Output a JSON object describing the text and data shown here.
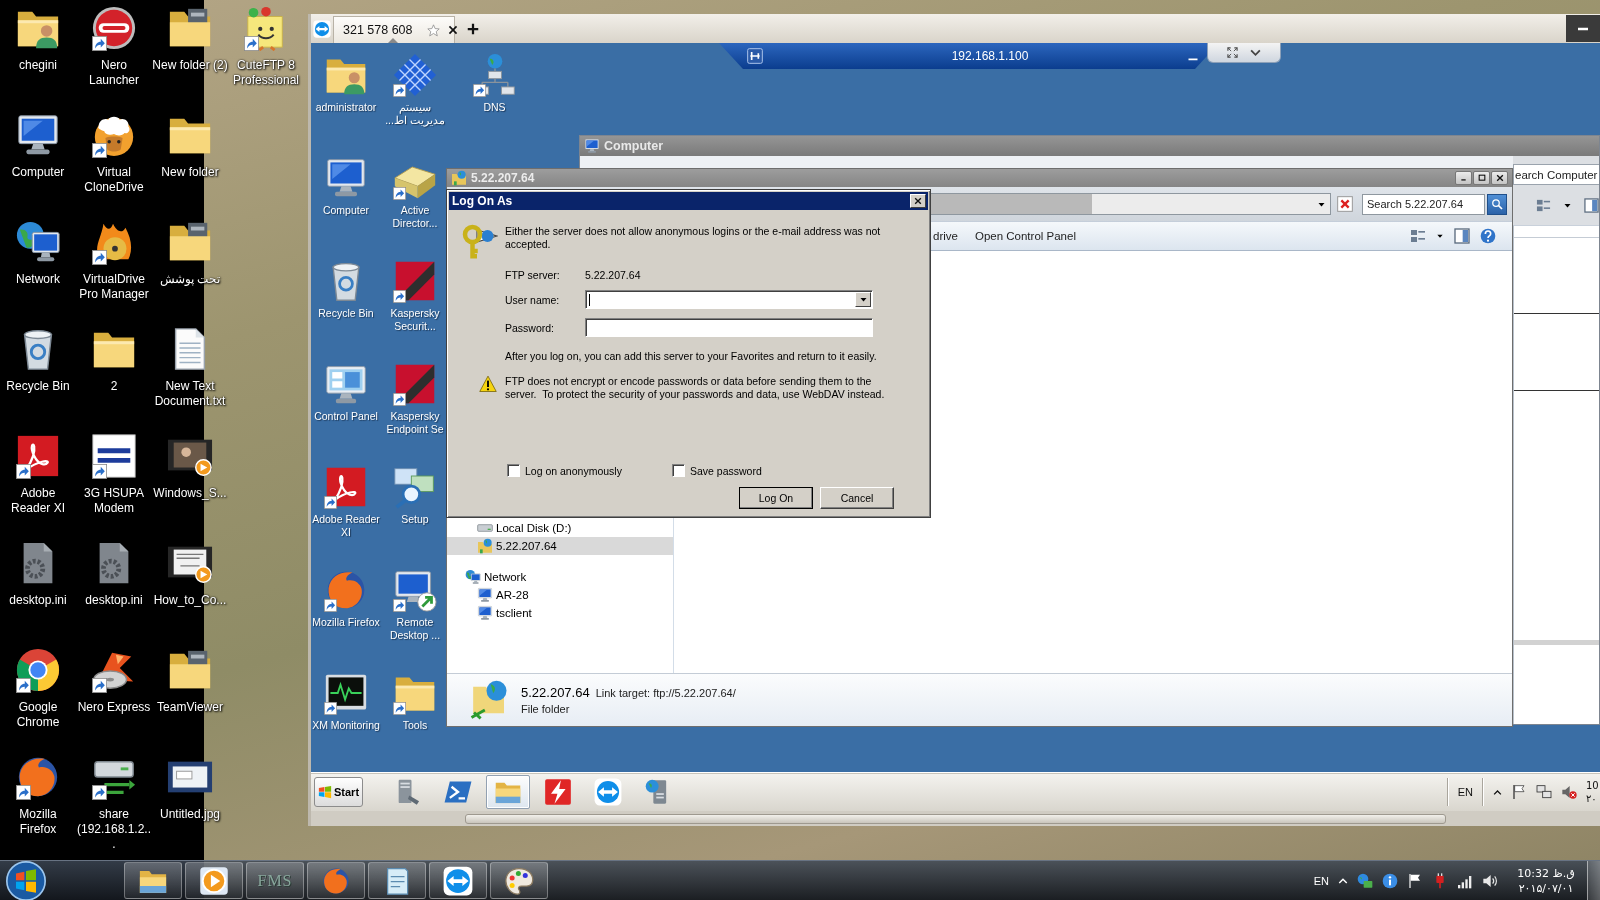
{
  "desktop": {
    "icons": [
      {
        "label": "chegini",
        "shortcut": false
      },
      {
        "label": "Computer",
        "shortcut": false
      },
      {
        "label": "Network",
        "shortcut": false
      },
      {
        "label": "Recycle Bin",
        "shortcut": false
      },
      {
        "label": "Adobe Reader XI",
        "shortcut": true
      },
      {
        "label": "desktop.ini",
        "shortcut": false
      },
      {
        "label": "Google Chrome",
        "shortcut": true
      },
      {
        "label": "Mozilla Firefox",
        "shortcut": true
      },
      {
        "label": "Nero Launcher",
        "shortcut": true
      },
      {
        "label": "Virtual CloneDrive",
        "shortcut": true
      },
      {
        "label": "VirtualDrive Pro Manager",
        "shortcut": true
      },
      {
        "label": "2",
        "shortcut": false
      },
      {
        "label": "3G HSUPA Modem",
        "shortcut": true
      },
      {
        "label": "desktop.ini",
        "shortcut": false
      },
      {
        "label": "Nero Express",
        "shortcut": true
      },
      {
        "label": "share (192.168.1.2...",
        "shortcut": true
      },
      {
        "label": "New folder (2)",
        "shortcut": false
      },
      {
        "label": "New folder",
        "shortcut": false
      },
      {
        "label": "تحت پوشش",
        "shortcut": false
      },
      {
        "label": "New Text Document.txt",
        "shortcut": false
      },
      {
        "label": "Windows_S...",
        "shortcut": false
      },
      {
        "label": "How_to_Co...",
        "shortcut": false
      },
      {
        "label": "TeamViewer",
        "shortcut": false
      },
      {
        "label": "Untitled.jpg",
        "shortcut": false
      },
      {
        "label": "CuteFTP 8 Professional",
        "shortcut": true
      }
    ]
  },
  "teamviewer": {
    "tabs": [
      {
        "label": "321 578 608",
        "selected": true
      }
    ]
  },
  "connection_bar": {
    "title": "192.168.1.100"
  },
  "remote_desktop": {
    "icons": [
      {
        "label": "administrator",
        "shortcut": false
      },
      {
        "label": "Computer",
        "shortcut": false
      },
      {
        "label": "Recycle Bin",
        "shortcut": false
      },
      {
        "label": "Control Panel",
        "shortcut": false
      },
      {
        "label": "Adobe Reader XI",
        "shortcut": true
      },
      {
        "label": "Mozilla Firefox",
        "shortcut": true
      },
      {
        "label": "XM Monitoring",
        "shortcut": true
      },
      {
        "label": "سیستم مدیریت اط...",
        "shortcut": true
      },
      {
        "label": "Active Director...",
        "shortcut": true
      },
      {
        "label": "Kaspersky Securit...",
        "shortcut": true
      },
      {
        "label": "Kaspersky Endpoint Se",
        "shortcut": true
      },
      {
        "label": "Setup",
        "shortcut": false
      },
      {
        "label": "Remote Desktop ...",
        "shortcut": true
      },
      {
        "label": "Tools",
        "shortcut": true
      },
      {
        "label": "DNS",
        "shortcut": true
      }
    ]
  },
  "computer_window": {
    "title": "Computer",
    "search": {
      "placeholder": "earch Computer"
    }
  },
  "explorer_window": {
    "title": "5.22.207.64",
    "search": {
      "placeholder": "Search 5.22.207.64"
    },
    "toolbar": [
      "drive",
      "Open Control Panel"
    ],
    "nav": {
      "computer_items": [
        {
          "label": "Local Disk (D:)",
          "selected": false
        },
        {
          "label": "5.22.207.64",
          "selected": true
        }
      ],
      "network": {
        "label": "Network",
        "selected": false,
        "children": [
          {
            "label": "AR-28",
            "selected": false
          },
          {
            "label": "tsclient",
            "selected": false
          }
        ]
      }
    },
    "details": {
      "name": "5.22.207.64",
      "link_target": "Link target: ftp://5.22.207.64/",
      "type": "File folder"
    }
  },
  "logon_dialog": {
    "title": "Log On As",
    "message": "Either the server does not allow anonymous logins or the e-mail address was not accepted.",
    "server": {
      "label": "FTP server:",
      "value": "5.22.207.64"
    },
    "user_name": {
      "label": "User name:",
      "focused": true
    },
    "password": {
      "label": "Password:",
      "focused": false
    },
    "info": "After you log on, you can add this server to your Favorites and return to it easily.",
    "warning": "FTP does not encrypt or encode passwords or data before sending them to the server.  To protect the security of your passwords and data, use WebDAV instead.",
    "options": [
      {
        "label": "Log on anonymously",
        "checked": false
      },
      {
        "label": "Save password",
        "checked": false
      }
    ],
    "buttons": [
      {
        "label": "Log On",
        "default": true
      },
      {
        "label": "Cancel",
        "default": false
      }
    ]
  },
  "remote_taskbar": {
    "start": "Start",
    "apps": [
      {
        "selected": false
      },
      {
        "selected": false
      },
      {
        "selected": true
      },
      {
        "selected": false
      },
      {
        "selected": false
      },
      {
        "selected": false
      }
    ],
    "language": "EN",
    "time": "10",
    "date": "۲۰"
  },
  "taskbar": {
    "app_text": "FMS",
    "language": "EN",
    "time": "ق.ظ 10:32",
    "date": "۲۰۱۵/۰۷/۰۱"
  }
}
